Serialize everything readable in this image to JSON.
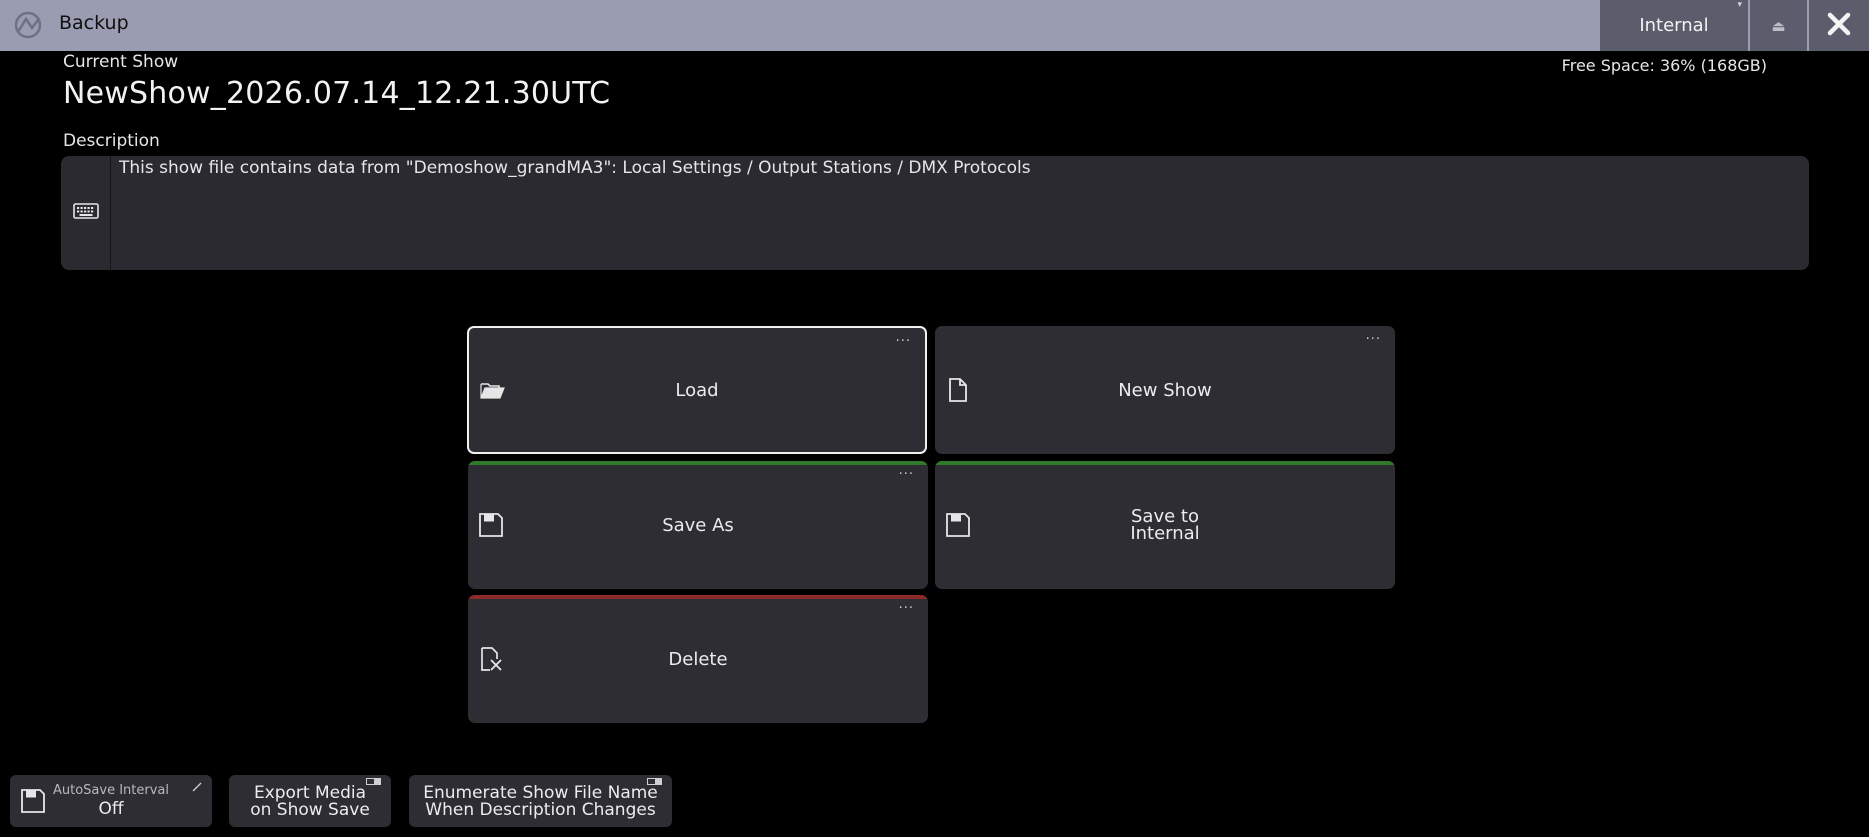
{
  "window": {
    "title": "Backup",
    "drive_label": "Internal",
    "drive_arrow": "▾",
    "eject_symbol": "⏏"
  },
  "show": {
    "current_label": "Current Show",
    "name": "NewShow_2026.07.14_12.21.30UTC",
    "free_space": "Free Space: 36% (168GB)",
    "description_label": "Description",
    "description_text": "This show file contains data from \"Demoshow_grandMA3\":  Local Settings / Output Stations / DMX Protocols"
  },
  "actions": {
    "load": {
      "label": "Load",
      "icon": "folder-open-icon",
      "more": "···"
    },
    "new_show": {
      "label": "New Show",
      "icon": "file-icon",
      "more": "···"
    },
    "save_as": {
      "label": "Save As",
      "icon": "floppy-icon",
      "more": "···",
      "accent": "#2f7a2a"
    },
    "save_internal": {
      "label_line1": "Save to",
      "label_line2": "Internal",
      "icon": "floppy-icon",
      "accent": "#2f7a2a"
    },
    "delete": {
      "label": "Delete",
      "icon": "delete-file-icon",
      "more": "···",
      "accent": "#8c2a2a"
    }
  },
  "bottom": {
    "autosave": {
      "title": "AutoSave Interval",
      "value": "Off"
    },
    "export_media": {
      "line1": "Export Media",
      "line2": "on Show Save"
    },
    "enumerate": {
      "line1": "Enumerate Show File Name",
      "line2": "When Description Changes"
    }
  },
  "colors": {
    "titlebar": "#9a9cb2",
    "button_bg": "#2d2d33",
    "selected_border": "#f0f0f0"
  }
}
